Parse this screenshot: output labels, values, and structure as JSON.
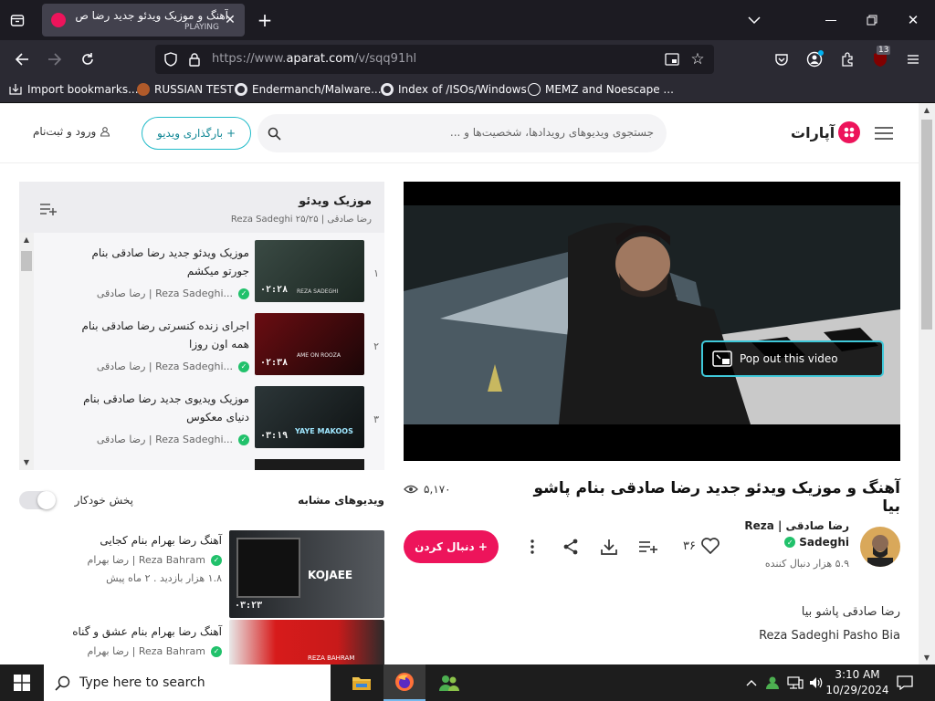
{
  "browser": {
    "tab_title": "آهنگ و موزیک ویدئو جدید رضا ص",
    "tab_status": "PLAYING",
    "url_prefix": "https://www.",
    "url_domain": "aparat.com",
    "url_path": "/v/sqq91hl",
    "extension_badge": "13",
    "bookmarks": [
      "Import bookmarks...",
      "RUSSIAN TEST",
      "Endermanch/Malware...",
      "Index of /ISOs/Windows",
      "MEMZ and Noescape ..."
    ]
  },
  "header": {
    "logo_text": "آپارات",
    "search_placeholder": "جستجوی ویدیوهای رویدادها، شخصیت‌ها و ...",
    "upload_label": "+ بارگذاری ویدیو",
    "login_label": "ورود و ثبت‌نام"
  },
  "player": {
    "popout_label": "Pop out this video",
    "video_title": "آهنگ و موزیک ویدئو جدید رضا صادقی بنام پاشو بیا",
    "views": "۵,۱۷۰",
    "likes": "۳۶",
    "follow_label": "+ دنبال کردن",
    "channel_name_1": "رضا صادقی | Reza",
    "channel_name_2": "Sadeghi",
    "followers": "۵.۹ هزار دنبال کننده",
    "description_1": "رضا صادقی پاشو بیا",
    "description_2": "Reza Sadeghi Pasho Bia"
  },
  "playlist": {
    "title": "موزیک ویدئو",
    "meta": "رضا صادقی | Reza Sadeghi ۲۵/۲۵",
    "items": [
      {
        "num": "۱",
        "title_1": "موزیک ویدئو جدید رضا صادقی بنام",
        "title_2": "جورتو میکشم",
        "channel": "رضا صادقی | Reza Sadeghi...",
        "duration": "۰۲:۲۸",
        "thumb_text": "REZA SADEGHI"
      },
      {
        "num": "۲",
        "title_1": "اجرای زنده کنسرتی رضا صادقی بنام",
        "title_2": "همه اون روزا",
        "channel": "رضا صادقی | Reza Sadeghi...",
        "duration": "۰۲:۳۸",
        "thumb_text": "AME ON ROOZA"
      },
      {
        "num": "۳",
        "title_1": "موزیک ویدیوی جدید رضا صادقی بنام",
        "title_2": "دنیای معکوس",
        "channel": "رضا صادقی | Reza Sadeghi...",
        "duration": "۰۳:۱۹",
        "thumb_text": "YAYE MAKOOS"
      }
    ]
  },
  "related": {
    "title": "ویدیوهای مشابه",
    "autoplay_label": "پخش خودکار",
    "items": [
      {
        "title": "آهنگ رضا بهرام بنام کجایی",
        "channel": "رضا بهرام | Reza Bahram",
        "meta": "۱.۸ هزار بازدید  .  ۲ ماه پیش",
        "duration": "۰۳:۲۳",
        "thumb_text": "KOJAEE"
      },
      {
        "title": "آهنگ رضا بهرام بنام عشق و گناه",
        "channel": "رضا بهرام | Reza Bahram",
        "meta": "",
        "duration": "",
        "thumb_text": "REZA BAHRAM"
      }
    ]
  },
  "taskbar": {
    "search_placeholder": "Type here to search",
    "time": "3:10 AM",
    "date": "10/29/2024"
  }
}
